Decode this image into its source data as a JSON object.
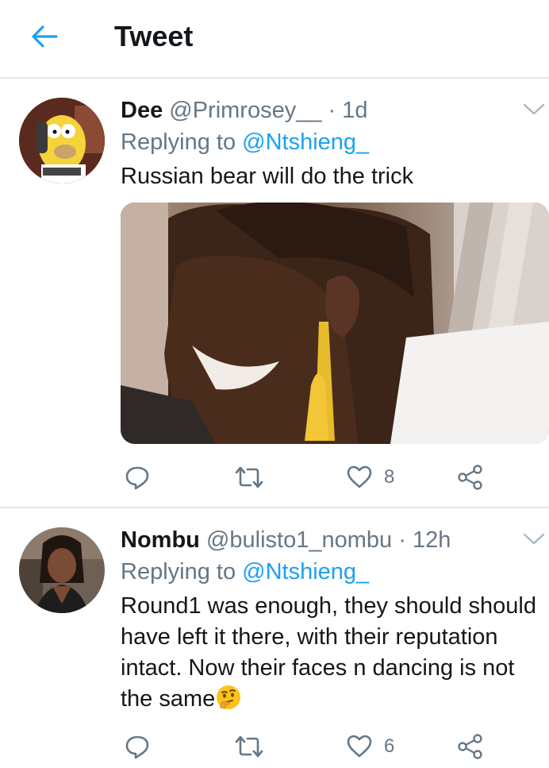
{
  "header": {
    "title": "Tweet",
    "back_icon": "arrow-left-icon",
    "accent_color": "#1da1f2"
  },
  "tweets": [
    {
      "display_name": "Dee",
      "handle": "@Primrosey__",
      "separator": "·",
      "time": "1d",
      "replying_prefix": "Replying to",
      "replying_to": "@Ntshieng_",
      "text": "Russian bear will do the trick",
      "has_media": true,
      "actions": {
        "reply_icon": "reply-icon",
        "retweet_icon": "retweet-icon",
        "like_icon": "heart-icon",
        "like_count": "8",
        "share_icon": "share-icon"
      }
    },
    {
      "display_name": "Nombu",
      "handle": "@bulisto1_nombu",
      "separator": "·",
      "time": "12h",
      "replying_prefix": "Replying to",
      "replying_to": "@Ntshieng_",
      "text": "Round1 was enough, they should should have left it there, with their reputation intact. Now their faces n dancing is not the same",
      "emoji": "thinking-face-emoji",
      "actions": {
        "reply_icon": "reply-icon",
        "retweet_icon": "retweet-icon",
        "like_icon": "heart-icon",
        "like_count": "6",
        "share_icon": "share-icon"
      }
    }
  ]
}
